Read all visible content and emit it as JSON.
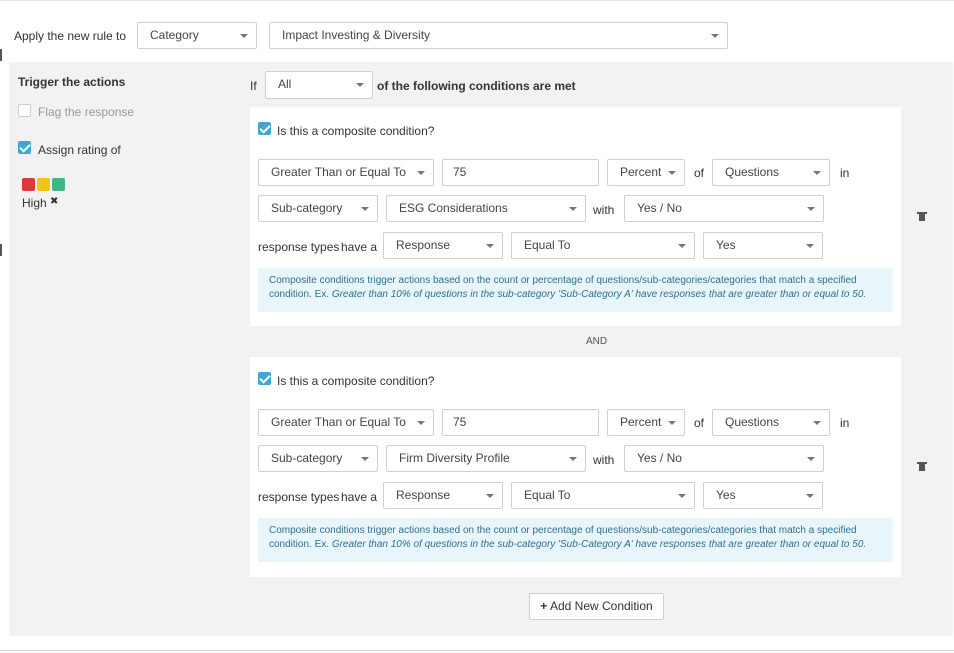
{
  "header": {
    "apply_label": "Apply the new rule to",
    "scope_select": "Category",
    "category_select": "Impact Investing & Diversity"
  },
  "actions": {
    "title": "Trigger the actions",
    "flag_label": "Flag the response",
    "assign_label": "Assign rating of",
    "rating_colors": [
      "#d93a3a",
      "#f2c318",
      "#3fb58a"
    ],
    "rating_value": "High",
    "remove_icon": "✖"
  },
  "condition_header": {
    "if_label": "If",
    "match_select": "All",
    "suffix": "of the following conditions are met"
  },
  "conditions": [
    {
      "composite_label": "Is this a composite condition?",
      "operator": "Greater Than or Equal To",
      "amount": "75",
      "unit": "Percent",
      "of_label": "of",
      "target": "Questions",
      "in_label": "in",
      "level": "Sub-category",
      "subcategory": "ESG Considerations",
      "with_label": "with",
      "answer_set": "Yes / No",
      "response_types_label": "response types",
      "have_a_label": "have a",
      "field": "Response",
      "comparison": "Equal To",
      "value": "Yes",
      "info_text": "Composite conditions trigger actions based on the count or percentage of questions/sub-categories/categories that match a specified",
      "info_prefix": "condition. Ex.",
      "info_example": "Greater than 10% of questions in the sub-category 'Sub-Category A' have responses that are greater than or equal to 50."
    },
    {
      "composite_label": "Is this a composite condition?",
      "operator": "Greater Than or Equal To",
      "amount": "75",
      "unit": "Percent",
      "of_label": "of",
      "target": "Questions",
      "in_label": "in",
      "level": "Sub-category",
      "subcategory": "Firm Diversity Profile",
      "with_label": "with",
      "answer_set": "Yes / No",
      "response_types_label": "response types",
      "have_a_label": "have a",
      "field": "Response",
      "comparison": "Equal To",
      "value": "Yes",
      "info_text": "Composite conditions trigger actions based on the count or percentage of questions/sub-categories/categories that match a specified",
      "info_prefix": "condition. Ex.",
      "info_example": "Greater than 10% of questions in the sub-category 'Sub-Category A' have responses that are greater than or equal to 50."
    }
  ],
  "joiner": "AND",
  "add_button": {
    "icon": "+",
    "label": "Add New Condition"
  },
  "icons": {
    "delete": "trash-icon",
    "dropdown": "caret-down-icon",
    "checkbox": "checkbox-icon"
  }
}
